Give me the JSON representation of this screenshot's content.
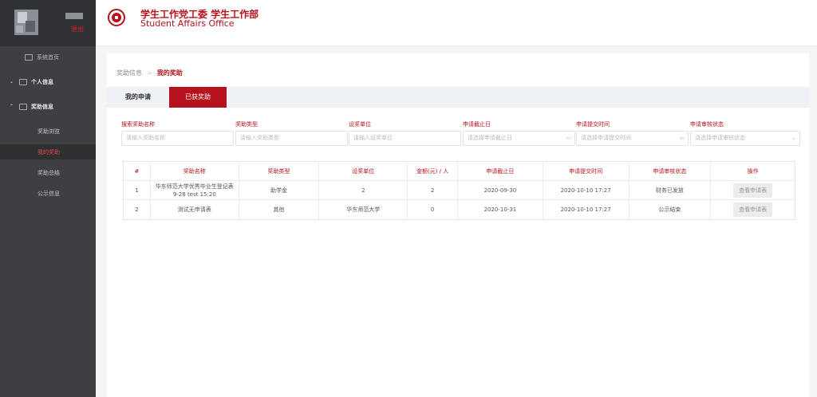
{
  "sidebar": {
    "logout": "退出",
    "items": {
      "home": "系统首页",
      "personal": "个人信息",
      "award": "奖助信息"
    },
    "sub": [
      "奖助浏览",
      "我的奖助",
      "奖助总结",
      "公示信息"
    ]
  },
  "header": {
    "title": "学生工作党工委 学生工作部",
    "subtitle": "Student Affairs Office"
  },
  "breadcrumb": {
    "parent": "奖助信息",
    "current": "我的奖助"
  },
  "tabs": {
    "mine": "我的申请",
    "got": "已获奖助"
  },
  "filters": [
    {
      "label": "搜索奖助名称",
      "placeholder": "请输入奖助名称",
      "suffix": ""
    },
    {
      "label": "奖助类型",
      "placeholder": "请输入奖助类型",
      "suffix": ""
    },
    {
      "label": "设奖单位",
      "placeholder": "请输入设奖单位",
      "suffix": ""
    },
    {
      "label": "申请截止日",
      "placeholder": "请选择申请截止日",
      "suffix": "▭"
    },
    {
      "label": "申请提交时间",
      "placeholder": "请选择申请提交时间",
      "suffix": "▭"
    },
    {
      "label": "申请审核状态",
      "placeholder": "请选择申请审核状态",
      "suffix": "⌄"
    }
  ],
  "table": {
    "headers": [
      "#",
      "奖助名称",
      "奖助类型",
      "设奖单位",
      "金额(元) / 人",
      "申请截止日",
      "申请提交时间",
      "申请审核状态",
      "操作"
    ],
    "rows": [
      {
        "no": "1",
        "name": "华东师范大学优秀毕业生登记表 9-28 test 15:20",
        "type": "助学金",
        "unit": "2",
        "amount": "2",
        "deadline": "2020-09-30",
        "submitted": "2020-10-10 17:27",
        "status": "财务已发放",
        "action": "查看申请表"
      },
      {
        "no": "2",
        "name": "测试无申请表",
        "type": "其他",
        "unit": "华东师范大学",
        "amount": "0",
        "deadline": "2020-10-31",
        "submitted": "2020-10-10 17:27",
        "status": "公示结束",
        "action": "查看申请表"
      }
    ]
  }
}
